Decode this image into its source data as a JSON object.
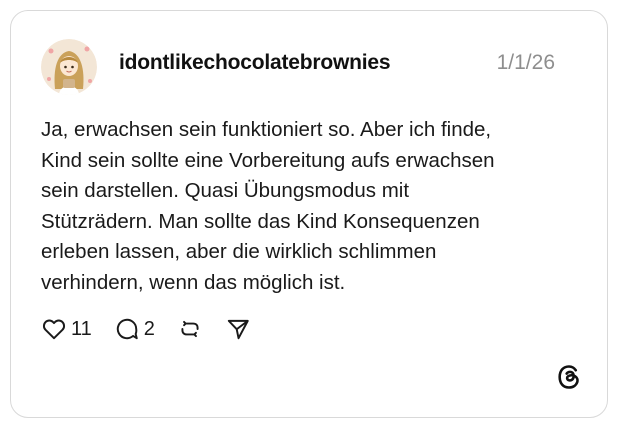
{
  "post": {
    "username": "idontlikechocolatebrownies",
    "date": "1/1/26",
    "text_lines": [
      "Ja, erwachsen sein funktioniert so. Aber ich finde,",
      "Kind sein sollte eine Vorbereitung aufs erwachsen",
      "sein darstellen. Quasi Übungsmodus mit",
      "Stützrädern. Man sollte das Kind Konsequenzen",
      "erleben lassen, aber die wirklich schlimmen",
      "verhindern, wenn das möglich ist."
    ]
  },
  "actions": {
    "like_count": "11",
    "reply_count": "2",
    "like_icon": "heart-icon",
    "reply_icon": "comment-icon",
    "repost_icon": "repost-icon",
    "share_icon": "share-icon"
  },
  "branding": {
    "logo": "threads-logo-icon"
  },
  "colors": {
    "text": "#1a1a1a",
    "muted": "#8e8e8e",
    "border": "#d9d9d9"
  }
}
